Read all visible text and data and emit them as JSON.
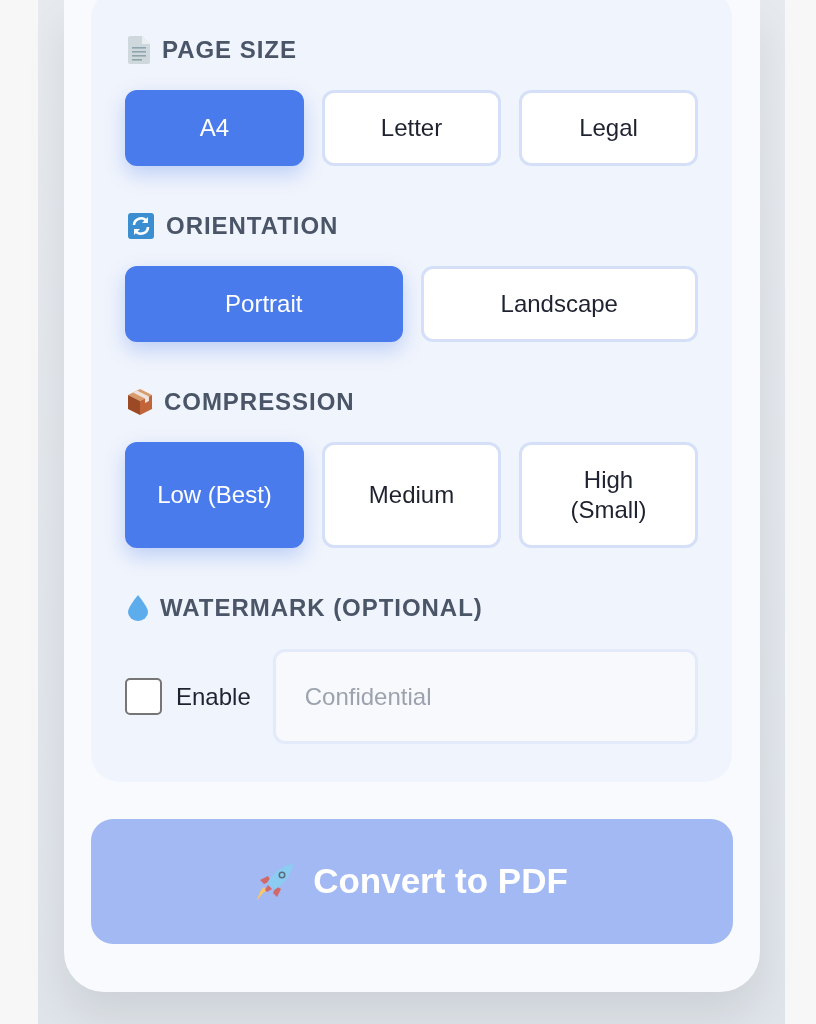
{
  "sections": [
    {
      "kind": "options",
      "title": "PAGE SIZE",
      "options": [
        {
          "label": "A4",
          "selected": true
        },
        {
          "label": "Letter",
          "selected": false
        },
        {
          "label": "Legal",
          "selected": false
        }
      ]
    },
    {
      "kind": "options",
      "title": "ORIENTATION",
      "options": [
        {
          "label": "Portrait",
          "selected": true
        },
        {
          "label": "Landscape",
          "selected": false
        }
      ]
    },
    {
      "kind": "options",
      "title": "COMPRESSION",
      "options": [
        {
          "label": "Low (Best)",
          "selected": true
        },
        {
          "label": "Medium",
          "selected": false
        },
        {
          "label": "High (Small)",
          "selected": false
        }
      ]
    },
    {
      "kind": "watermark",
      "title": "WATERMARK (OPTIONAL)",
      "checkbox": {
        "label": "Enable",
        "checked": false
      },
      "input": {
        "placeholder": "Confidential"
      }
    }
  ],
  "convert_button": {
    "label": "Convert to PDF",
    "disabled": true
  }
}
